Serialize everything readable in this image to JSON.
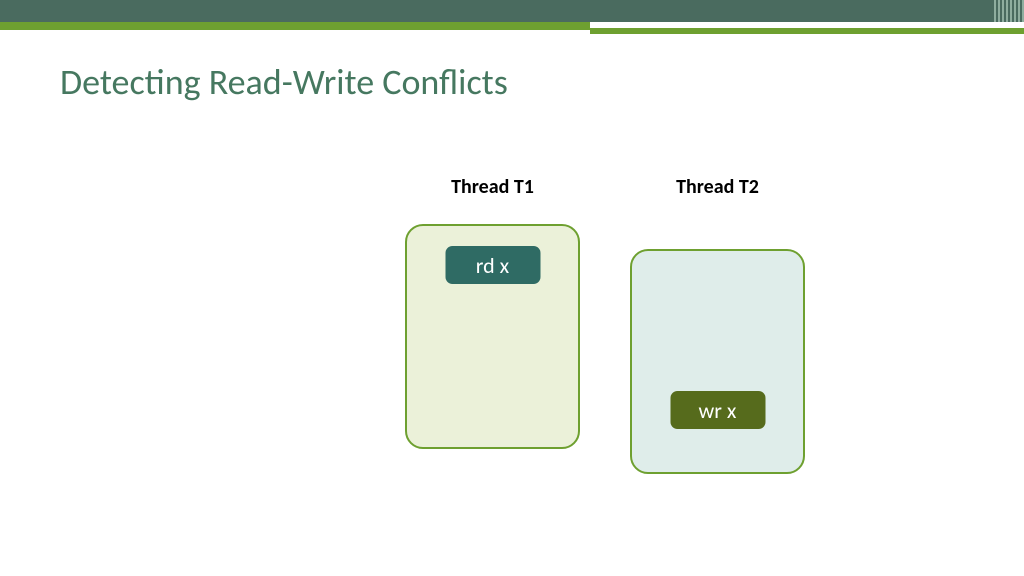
{
  "title": "Detecting Read-Write Conflicts",
  "threads": {
    "t1": {
      "label": "Thread T1",
      "op": "rd x"
    },
    "t2": {
      "label": "Thread T2",
      "op": "wr x"
    }
  }
}
